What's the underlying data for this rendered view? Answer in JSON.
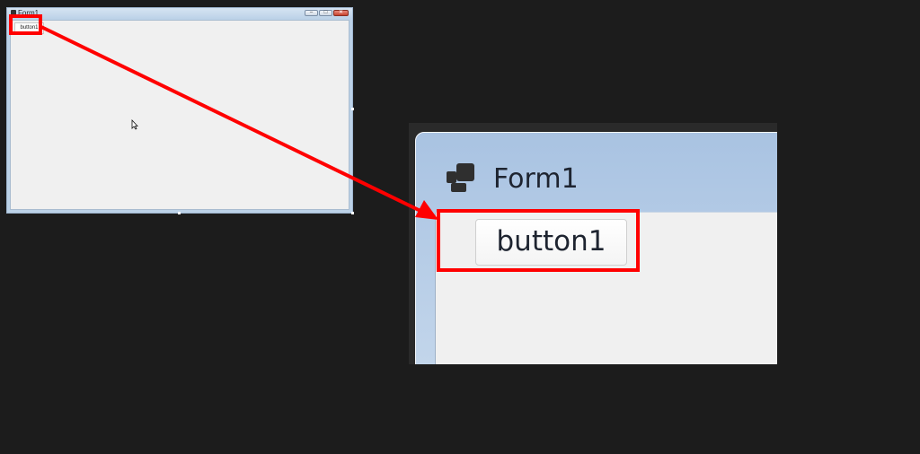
{
  "mini_window": {
    "title": "Form1",
    "button_label": "button1",
    "controls": {
      "minimize": "–",
      "maximize": "□",
      "close": "✕"
    }
  },
  "zoom_window": {
    "title": "Form1",
    "button_label": "button1"
  },
  "icons": {
    "window_icon": "form-icon",
    "cursor": "mouse-pointer-icon",
    "arrow": "callout-arrow"
  },
  "colors": {
    "highlight": "#ff0000",
    "background": "#1c1c1c",
    "client": "#f0f0f0",
    "titlebar": "#bcd2e8"
  }
}
